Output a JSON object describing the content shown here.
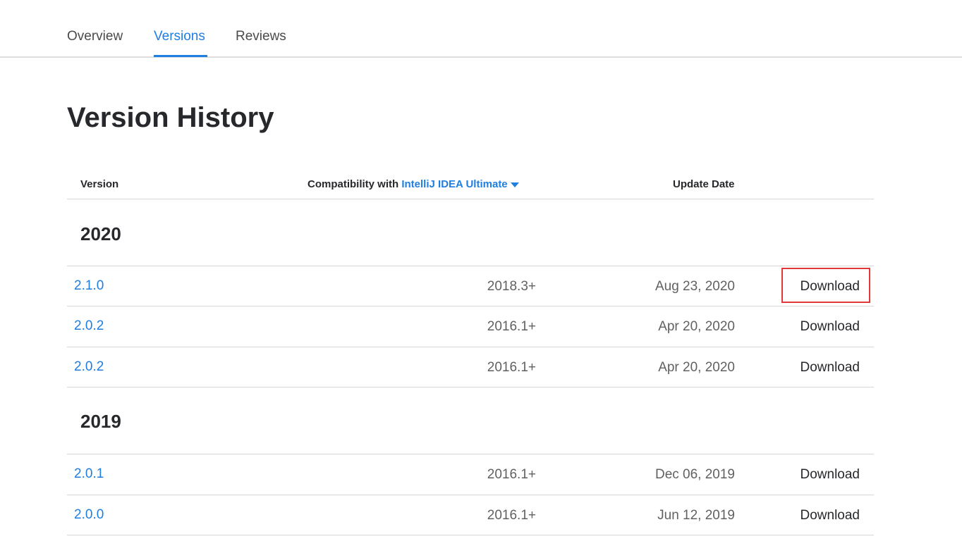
{
  "tabs": {
    "overview": "Overview",
    "versions": "Versions",
    "reviews": "Reviews"
  },
  "page_title": "Version History",
  "table": {
    "headers": {
      "version": "Version",
      "compat_prefix": "Compatibility with",
      "compat_product": "IntelliJ IDEA Ultimate",
      "update_date": "Update Date"
    },
    "groups": [
      {
        "year": "2020",
        "rows": [
          {
            "version": "2.1.0",
            "compat": "2018.3+",
            "date": "Aug 23, 2020",
            "action": "Download"
          },
          {
            "version": "2.0.2",
            "compat": "2016.1+",
            "date": "Apr 20, 2020",
            "action": "Download"
          },
          {
            "version": "2.0.2",
            "compat": "2016.1+",
            "date": "Apr 20, 2020",
            "action": "Download"
          }
        ]
      },
      {
        "year": "2019",
        "rows": [
          {
            "version": "2.0.1",
            "compat": "2016.1+",
            "date": "Dec 06, 2019",
            "action": "Download"
          },
          {
            "version": "2.0.0",
            "compat": "2016.1+",
            "date": "Jun 12, 2019",
            "action": "Download"
          }
        ]
      }
    ]
  },
  "colors": {
    "accent": "#1f7ee0",
    "highlight": "#e0373a"
  }
}
